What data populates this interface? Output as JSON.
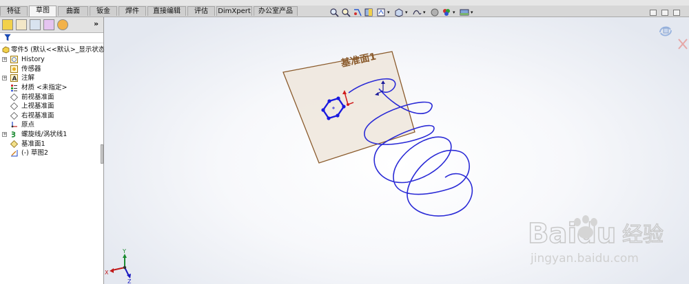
{
  "command_tabs": [
    {
      "label": "特征",
      "active": false
    },
    {
      "label": "草图",
      "active": true
    },
    {
      "label": "曲面",
      "active": false
    },
    {
      "label": "钣金",
      "active": false
    },
    {
      "label": "焊件",
      "active": false
    },
    {
      "label": "直接编辑",
      "active": false
    },
    {
      "label": "评估",
      "active": false
    },
    {
      "label": "DimXpert",
      "active": false
    },
    {
      "label": "办公室产品",
      "active": false
    }
  ],
  "panel": {
    "collapse_glyph": "»",
    "filter_icon": "filter-icon",
    "part_name": "零件5 (默认<<默认>_显示状态"
  },
  "tree": {
    "items": [
      {
        "label": "History",
        "icon": "history-icon"
      },
      {
        "label": "传感器",
        "icon": "sensor-icon"
      },
      {
        "label": "注解",
        "icon": "annotation-icon"
      },
      {
        "label": "材质 <未指定>",
        "icon": "material-icon"
      },
      {
        "label": "前视基准面",
        "icon": "plane-icon"
      },
      {
        "label": "上视基准面",
        "icon": "plane-icon"
      },
      {
        "label": "右视基准面",
        "icon": "plane-icon"
      },
      {
        "label": "原点",
        "icon": "origin-icon"
      },
      {
        "label": "螺旋线/涡状线1",
        "icon": "helix-icon"
      },
      {
        "label": "基准面1",
        "icon": "plane-icon"
      },
      {
        "label": "(-) 草图2",
        "icon": "sketch-icon"
      }
    ]
  },
  "viewport": {
    "plane_label": "基准面1",
    "triad": {
      "x": "X",
      "y": "Y",
      "z": "Z"
    }
  },
  "watermark": {
    "brand": "Baidu",
    "brand_suffix": "经验",
    "url": "jingyan.baidu.com"
  },
  "colors": {
    "helix": "#2a2ad6",
    "plane_border": "#8a5a2b",
    "plane_fill": "#efe6dc",
    "plane_label": "#8a5a2b",
    "sketch": "#1a1adf",
    "active_tab": "#f5f5f5",
    "watermark": "#c8c8c8"
  }
}
